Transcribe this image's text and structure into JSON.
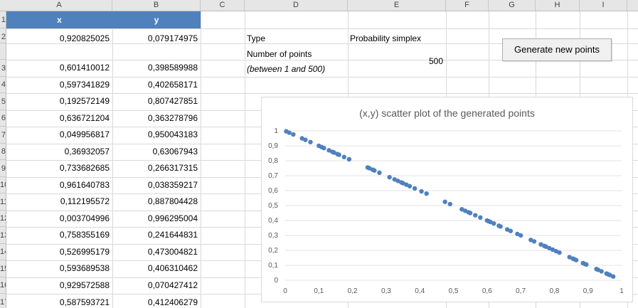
{
  "columns": [
    "A",
    "B",
    "C",
    "D",
    "E",
    "F",
    "G",
    "H",
    "I"
  ],
  "rows": [
    "1",
    "2",
    "",
    "3",
    "4",
    "5",
    "6",
    "7",
    "8",
    "9",
    "10",
    "11",
    "12",
    "13",
    "14",
    "15",
    "16",
    "17"
  ],
  "table": {
    "headers": [
      "x",
      "y"
    ],
    "rows": [
      [
        "0,920825025",
        "0,079174975"
      ],
      [
        "0,601410012",
        "0,398589988"
      ],
      [
        "0,597341829",
        "0,402658171"
      ],
      [
        "0,192572149",
        "0,807427851"
      ],
      [
        "0,636721204",
        "0,363278796"
      ],
      [
        "0,049956817",
        "0,950043183"
      ],
      [
        "0,36932057",
        "0,63067943"
      ],
      [
        "0,733682685",
        "0,266317315"
      ],
      [
        "0,961640783",
        "0,038359217"
      ],
      [
        "0,112195572",
        "0,887804428"
      ],
      [
        "0,003704996",
        "0,996295004"
      ],
      [
        "0,758355169",
        "0,241644831"
      ],
      [
        "0,526995179",
        "0,473004821"
      ],
      [
        "0,593689538",
        "0,406310462"
      ],
      [
        "0,929572588",
        "0,070427412"
      ],
      [
        "0,587593721",
        "0,412406279"
      ]
    ]
  },
  "settings": {
    "type_label": "Type",
    "type_value": "Probability simplex",
    "points_label": "Number of points",
    "points_hint": "(between 1 and 500)",
    "points_value": "500"
  },
  "button": {
    "label": "Generate new points"
  },
  "colors": {
    "header_fill": "#4f81bd",
    "marker": "#4f81bd"
  },
  "chart_data": {
    "type": "scatter",
    "title": "(x,y) scatter plot of the generated points",
    "xlim": [
      0,
      1
    ],
    "ylim": [
      0,
      1
    ],
    "x_ticks": [
      "0",
      "0,1",
      "0,2",
      "0,3",
      "0,4",
      "0,5",
      "0,6",
      "0,7",
      "0,8",
      "0,9",
      "1"
    ],
    "y_ticks": [
      "0",
      "0,1",
      "0,2",
      "0,3",
      "0,4",
      "0,5",
      "0,6",
      "0,7",
      "0,8",
      "0,9",
      "1"
    ],
    "grid": "horizontal",
    "series": [
      {
        "x": [
          0.003,
          0.012,
          0.024,
          0.05,
          0.06,
          0.075,
          0.1,
          0.108,
          0.115,
          0.13,
          0.14,
          0.145,
          0.155,
          0.16,
          0.175,
          0.19,
          0.19,
          0.245,
          0.25,
          0.26,
          0.265,
          0.28,
          0.31,
          0.325,
          0.335,
          0.345,
          0.35,
          0.36,
          0.37,
          0.385,
          0.405,
          0.42,
          0.475,
          0.49,
          0.525,
          0.535,
          0.545,
          0.55,
          0.565,
          0.58,
          0.6,
          0.605,
          0.61,
          0.62,
          0.635,
          0.64,
          0.66,
          0.67,
          0.69,
          0.7,
          0.73,
          0.74,
          0.76,
          0.77,
          0.775,
          0.785,
          0.795,
          0.805,
          0.815,
          0.845,
          0.855,
          0.86,
          0.865,
          0.885,
          0.89,
          0.895,
          0.925,
          0.93,
          0.94,
          0.955,
          0.96,
          0.965,
          0.975
        ],
        "y": [
          0.997,
          0.988,
          0.976,
          0.95,
          0.94,
          0.925,
          0.9,
          0.892,
          0.885,
          0.87,
          0.86,
          0.855,
          0.845,
          0.84,
          0.825,
          0.81,
          0.81,
          0.755,
          0.75,
          0.74,
          0.735,
          0.72,
          0.69,
          0.675,
          0.665,
          0.655,
          0.65,
          0.64,
          0.63,
          0.615,
          0.595,
          0.58,
          0.525,
          0.51,
          0.475,
          0.465,
          0.455,
          0.45,
          0.435,
          0.42,
          0.4,
          0.395,
          0.39,
          0.38,
          0.365,
          0.36,
          0.34,
          0.33,
          0.31,
          0.3,
          0.27,
          0.26,
          0.24,
          0.23,
          0.225,
          0.215,
          0.205,
          0.195,
          0.185,
          0.155,
          0.145,
          0.14,
          0.135,
          0.115,
          0.11,
          0.105,
          0.075,
          0.07,
          0.06,
          0.045,
          0.04,
          0.035,
          0.025
        ]
      }
    ]
  }
}
